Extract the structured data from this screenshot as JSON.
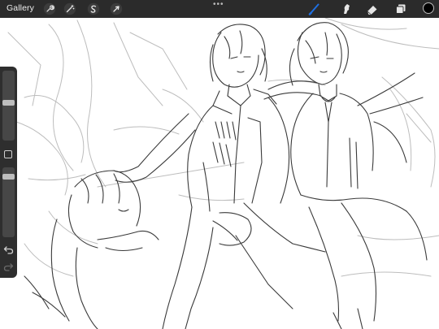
{
  "toolbar": {
    "gallery_label": "Gallery",
    "more_label": "•••",
    "actions_icon": "wrench-icon",
    "adjustments_icon": "magic-wand-icon",
    "selection_icon": "selection-s-icon",
    "transform_icon": "arrow-cursor-icon",
    "brush_icon": "brush-icon",
    "smudge_icon": "smudge-icon",
    "eraser_icon": "eraser-icon",
    "layers_icon": "layers-icon",
    "active_tool": "brush",
    "active_color": "#1f6fe0",
    "current_color": "#000000"
  },
  "sidebar": {
    "brush_size_level": 0.55,
    "opacity_level": 0.1,
    "undo_icon": "undo-icon",
    "redo_icon": "redo-icon",
    "modify_icon": "square-icon"
  },
  "canvas": {
    "description_icon": "sketch-artwork",
    "stroke_color": "#3a3a3a",
    "guide_color": "#b5b5b5"
  }
}
